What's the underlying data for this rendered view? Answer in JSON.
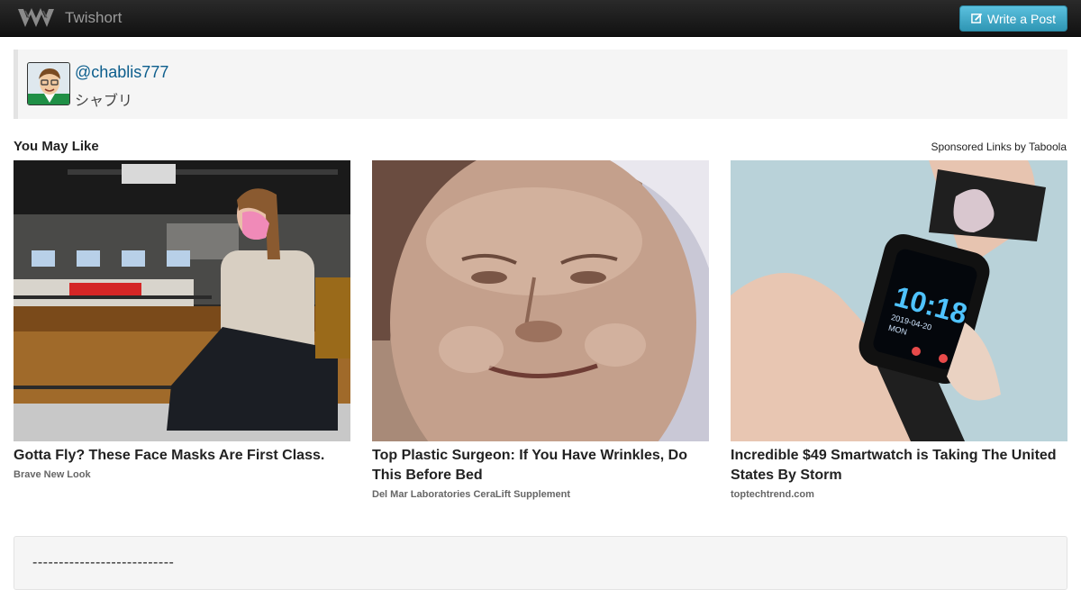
{
  "navbar": {
    "brand": "Twishort",
    "write_button": "Write a Post"
  },
  "user": {
    "handle": "@chablis777",
    "display_name": "シャブリ"
  },
  "recommendations": {
    "title": "You May Like",
    "sponsored_label": "Sponsored Links by Taboola",
    "items": [
      {
        "headline": "Gotta Fly? These Face Masks Are First Class.",
        "source": "Brave New Look"
      },
      {
        "headline": "Top Plastic Surgeon: If You Have Wrinkles, Do This Before Bed",
        "source": "Del Mar Laboratories CeraLift Supplement"
      },
      {
        "headline": "Incredible $49 Smartwatch is Taking The United States By Storm",
        "source": "toptechtrend.com"
      }
    ]
  },
  "post": {
    "text": "---------------------------"
  },
  "watch": {
    "time": "10:18",
    "date": "2019-04-20",
    "day": "MON"
  },
  "colors": {
    "navbar": "#1b1b1b",
    "button": "#49afcd",
    "link": "#0b5d8c"
  }
}
